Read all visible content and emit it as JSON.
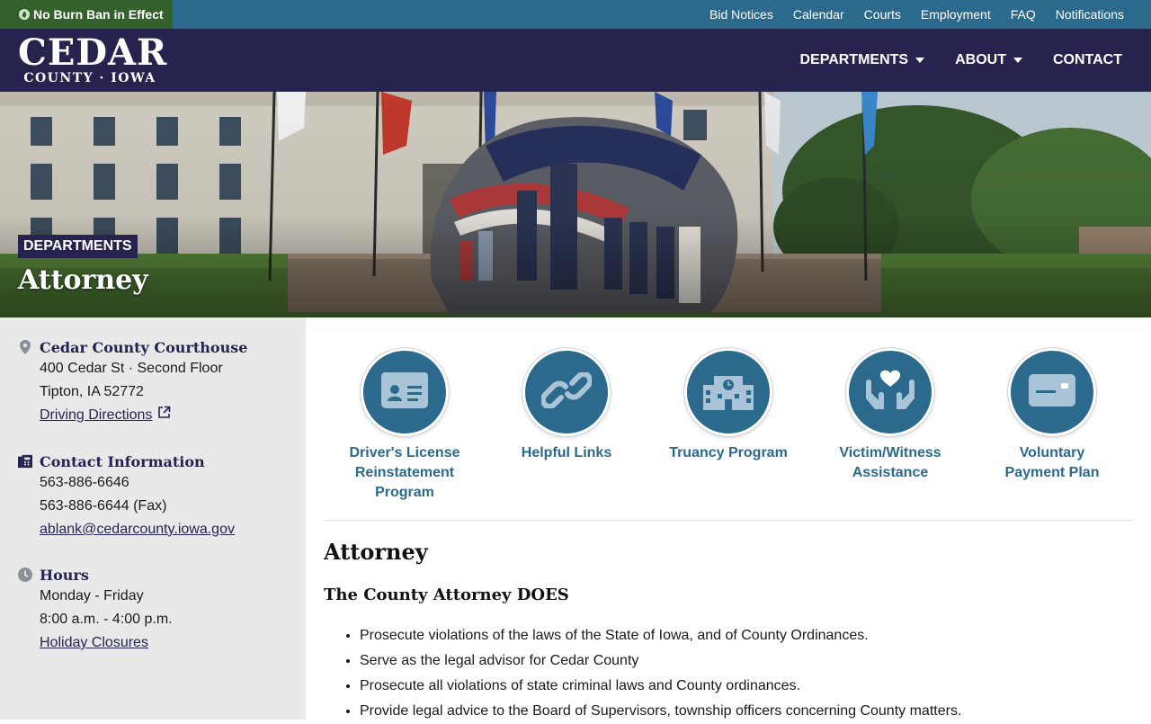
{
  "alert": {
    "text": "No Burn Ban in Effect"
  },
  "utility_nav": [
    "Bid Notices",
    "Calendar",
    "Courts",
    "Employment",
    "FAQ",
    "Notifications"
  ],
  "logo": {
    "main": "CEDAR",
    "sub": "COUNTY · IOWA"
  },
  "main_nav": [
    {
      "label": "DEPARTMENTS",
      "dropdown": true
    },
    {
      "label": "ABOUT",
      "dropdown": true
    },
    {
      "label": "CONTACT",
      "dropdown": false
    }
  ],
  "hero": {
    "badge": "DEPARTMENTS",
    "title": "Attorney"
  },
  "sidebar": {
    "location": {
      "heading": "Cedar County Courthouse",
      "line1": "400 Cedar St · Second Floor",
      "line2": "Tipton, IA 52772",
      "link": "Driving Directions"
    },
    "contact": {
      "heading": "Contact Information",
      "phone": "563-886-6646",
      "fax": "563-886-6644 (Fax)",
      "email": "ablank@cedarcounty.iowa.gov"
    },
    "hours": {
      "heading": "Hours",
      "days": "Monday - Friday",
      "time": "8:00 a.m. - 4:00 p.m.",
      "link": "Holiday Closures"
    }
  },
  "quick_links": [
    {
      "label": "Driver's License Reinstatement Program",
      "icon": "id-card-icon"
    },
    {
      "label": "Helpful Links",
      "icon": "link-icon"
    },
    {
      "label": "Truancy Program",
      "icon": "school-icon"
    },
    {
      "label": "Victim/Witness Assistance",
      "icon": "hands-heart-icon"
    },
    {
      "label": "Voluntary Payment Plan",
      "icon": "credit-card-icon"
    }
  ],
  "article": {
    "title": "Attorney",
    "subtitle": "The County Attorney DOES",
    "bullets": [
      "Prosecute violations of the laws of the State of Iowa, and of County Ordinances.",
      "Serve as the legal advisor for Cedar County",
      "Prosecute all violations of state criminal laws and County ordinances.",
      "Provide legal advice to the Board of Supervisors, township officers concerning County matters."
    ]
  },
  "colors": {
    "utility_bar": "#2b6a8c",
    "alert_green": "#33602b",
    "header_navy": "#26244f",
    "accent_blue": "#2b6a8c",
    "sidebar_bg": "#e9e9ea"
  }
}
